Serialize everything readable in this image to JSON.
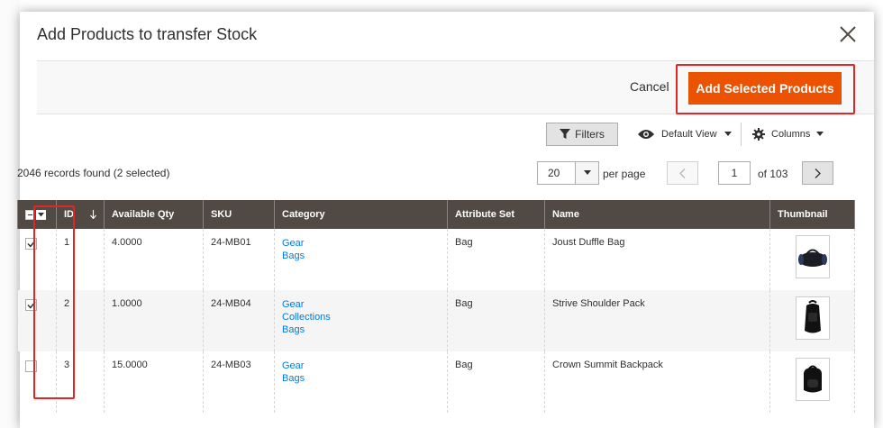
{
  "modal": {
    "title": "Add Products to transfer Stock",
    "close_icon": "close-icon"
  },
  "toolbar": {
    "cancel_label": "Cancel",
    "add_label": "Add Selected Products",
    "accent_color": "#eb5202"
  },
  "controls": {
    "filters_label": "Filters",
    "filters_icon": "funnel-icon",
    "view_label": "Default View",
    "view_icon": "eye-icon",
    "columns_label": "Columns",
    "columns_icon": "gear-icon"
  },
  "grid_info": {
    "records_text": "2046 records found (2 selected)",
    "per_page_value": "20",
    "per_page_label": "per page",
    "current_page": "1",
    "total_pages_text": "of 103"
  },
  "table": {
    "header_bg": "#514943",
    "columns": [
      "ID",
      "Available Qty",
      "SKU",
      "Category",
      "Attribute Set",
      "Name",
      "Thumbnail"
    ],
    "rows": [
      {
        "checked": true,
        "id": "1",
        "qty": "4.0000",
        "sku": "24-MB01",
        "category": [
          "Gear",
          "Bags"
        ],
        "attribute_set": "Bag",
        "name": "Joust Duffle Bag",
        "thumb_icon": "duffle-bag-icon"
      },
      {
        "checked": true,
        "id": "2",
        "qty": "1.0000",
        "sku": "24-MB04",
        "category": [
          "Gear",
          "Collections",
          "Bags"
        ],
        "attribute_set": "Bag",
        "name": "Strive Shoulder Pack",
        "thumb_icon": "shoulder-pack-icon"
      },
      {
        "checked": false,
        "id": "3",
        "qty": "15.0000",
        "sku": "24-MB03",
        "category": [
          "Gear",
          "Bags"
        ],
        "attribute_set": "Bag",
        "name": "Crown Summit Backpack",
        "thumb_icon": "backpack-icon"
      }
    ]
  }
}
